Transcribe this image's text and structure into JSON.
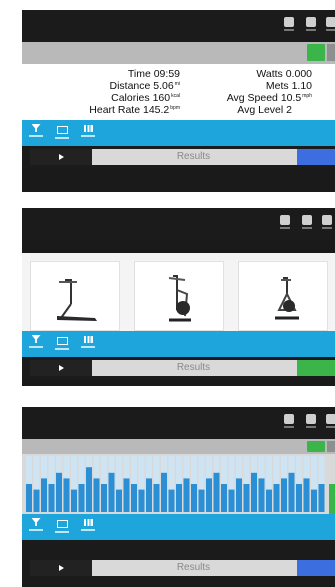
{
  "colors": {
    "accent_blue": "#1ea5dc",
    "action_green": "#3bb54a",
    "action_blue": "#3d6ee0",
    "bar_blue": "#2b8fd6",
    "bar_light": "#cfe4f3"
  },
  "screens": [
    {
      "stats": {
        "left": [
          {
            "label": "Time",
            "value": "09:59",
            "unit": ""
          },
          {
            "label": "Distance",
            "value": "5.06",
            "unit": "mi"
          },
          {
            "label": "Calories",
            "value": "160",
            "unit": "kcal"
          },
          {
            "label": "Heart Rate",
            "value": "145.2",
            "unit": "bpm"
          }
        ],
        "right": [
          {
            "label": "Watts",
            "value": "0.000",
            "unit": ""
          },
          {
            "label": "Mets",
            "value": "1.10",
            "unit": ""
          },
          {
            "label": "Avg Speed",
            "value": "10.5",
            "unit": "mph"
          },
          {
            "label": "Avg Level",
            "value": "2",
            "unit": ""
          }
        ]
      },
      "results_label": "Results",
      "action_icon": "blue-action-button"
    },
    {
      "cards": [
        {
          "caption": "",
          "icon": "treadmill"
        },
        {
          "caption": "",
          "icon": "elliptical"
        },
        {
          "caption": "",
          "icon": "exercise-bike"
        }
      ],
      "results_label": "Results",
      "action_icon": "green-action-button"
    },
    {
      "level_profile": [
        5,
        4,
        6,
        5,
        7,
        6,
        4,
        5,
        8,
        6,
        5,
        7,
        4,
        6,
        5,
        4,
        6,
        5,
        7,
        4,
        5,
        6,
        5,
        4,
        6,
        7,
        5,
        4,
        6,
        5,
        7,
        6,
        4,
        5,
        6,
        7,
        5,
        6,
        4,
        5
      ],
      "results_label": "Results",
      "action_icon": "blue-action-button"
    }
  ]
}
